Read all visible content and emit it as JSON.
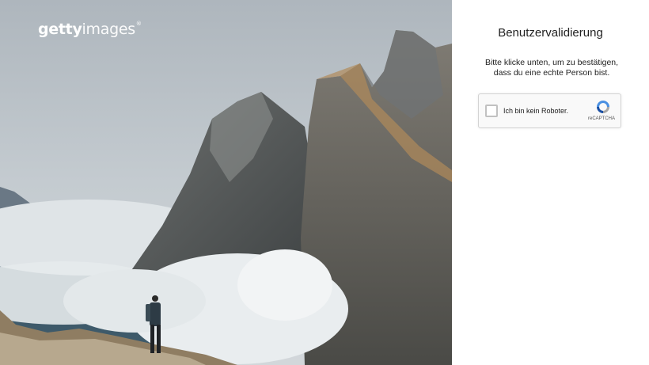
{
  "hero": {
    "brand_bold": "getty",
    "brand_light": "images",
    "brand_mark": "®",
    "logo_icon": "gettyimages-logo"
  },
  "panel": {
    "title": "Benutzervalidierung",
    "description": "Bitte klicke unten, um zu bestätigen, dass du eine echte Person bist."
  },
  "captcha": {
    "label": "Ich bin kein Roboter.",
    "brand": "reCAPTCHA",
    "icon": "recaptcha-icon",
    "checked": false
  }
}
